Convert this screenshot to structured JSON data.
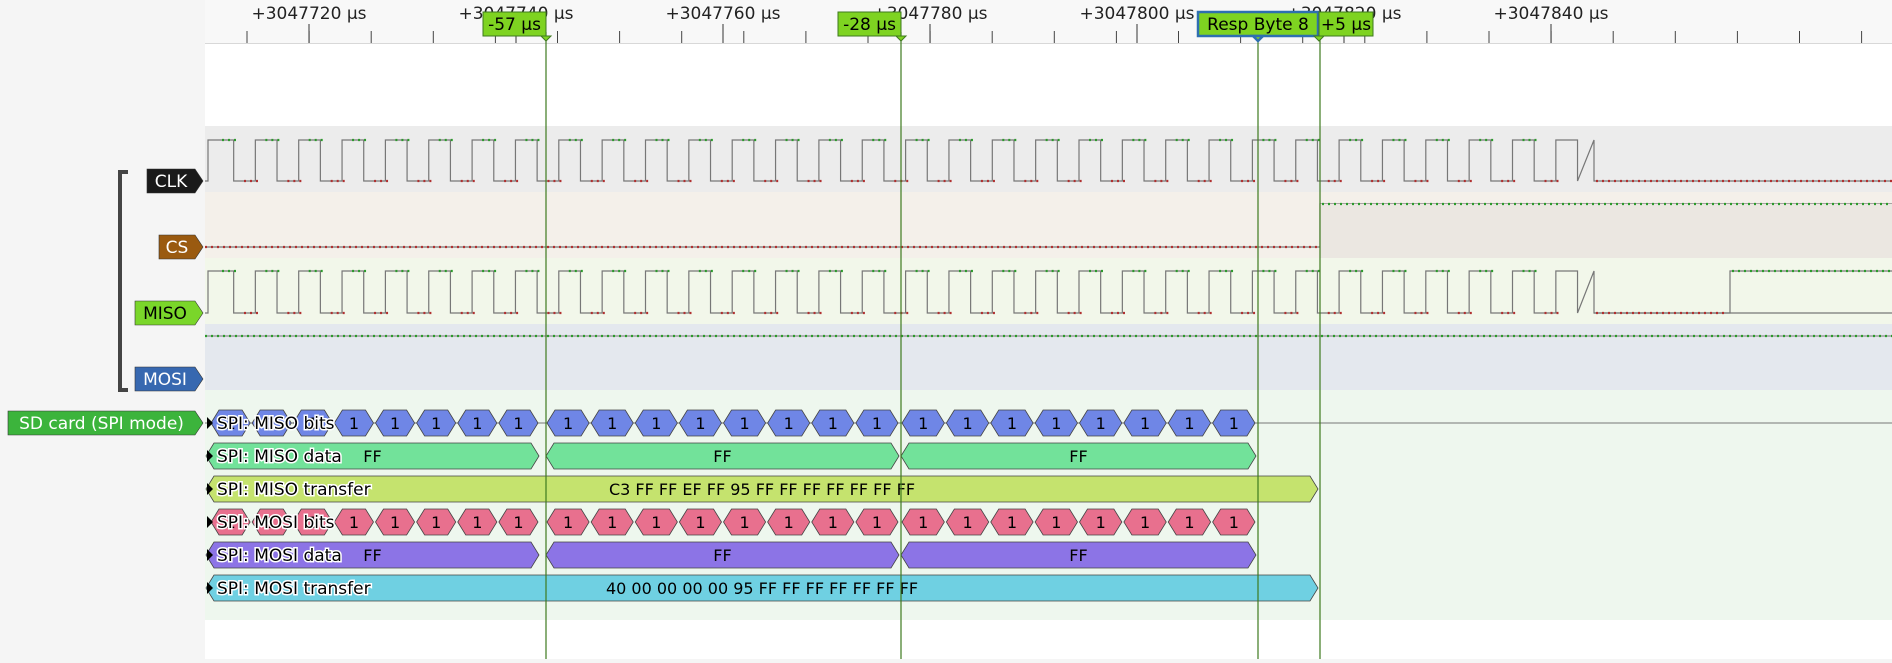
{
  "ruler": {
    "ticks": [
      {
        "label": "+3047720 µs",
        "us": 3047720
      },
      {
        "label": "+3047740 µs",
        "us": 3047740
      },
      {
        "label": "+3047760 µs",
        "us": 3047760
      },
      {
        "label": "+3047780 µs",
        "us": 3047780
      },
      {
        "label": "+3047800 µs",
        "us": 3047800
      },
      {
        "label": "+3047820 µs",
        "us": 3047820
      },
      {
        "label": "+3047840 µs",
        "us": 3047840
      }
    ]
  },
  "flags": [
    {
      "label": "-57 µs",
      "highlight": false
    },
    {
      "label": "-28 µs",
      "highlight": false
    },
    {
      "label": "Resp Byte 8",
      "highlight": true
    },
    {
      "label": "+5 µs",
      "highlight": false
    }
  ],
  "channels": [
    {
      "label": "CLK",
      "color": "#1a1a1a",
      "text_color": "#ffffff",
      "track": "#ececec"
    },
    {
      "label": "CS",
      "color": "#9a5a10",
      "text_color": "#ffffff",
      "track": "#f4f0ea"
    },
    {
      "label": "MISO",
      "color": "#7ad62a",
      "text_color": "#000000",
      "track": "#f2f7ea"
    },
    {
      "label": "MOSI",
      "color": "#3768b0",
      "text_color": "#ffffff",
      "track": "#e4e8ee"
    }
  ],
  "decoder": {
    "label": "SD card (SPI mode)",
    "color": "#3cb43c",
    "rows": [
      {
        "label": "SPI: MISO bits",
        "kind": "bits",
        "color": "#6f86e6",
        "values": [
          "1",
          "1",
          "1",
          "1",
          "1",
          "1",
          "1",
          "1",
          "1",
          "1",
          "1",
          "1",
          "1",
          "1",
          "1",
          "1",
          "1",
          "1",
          "1",
          "1",
          "1",
          "1",
          "1",
          "1"
        ]
      },
      {
        "label": "SPI: MISO data",
        "kind": "bytes",
        "color": "#72e29a",
        "values": [
          "FF",
          "FF",
          "FF"
        ]
      },
      {
        "label": "SPI: MISO transfer",
        "kind": "transfer",
        "color": "#c5e36e",
        "value": "C3 FF FF EF FF 95 FF FF FF FF FF FF FF"
      },
      {
        "label": "SPI: MOSI bits",
        "kind": "bits",
        "color": "#e8708e",
        "values": [
          "1",
          "1",
          "1",
          "1",
          "1",
          "1",
          "1",
          "1",
          "1",
          "1",
          "1",
          "1",
          "1",
          "1",
          "1",
          "1",
          "1",
          "1",
          "1",
          "1",
          "1",
          "1",
          "1",
          "1"
        ]
      },
      {
        "label": "SPI: MOSI data",
        "kind": "bytes",
        "color": "#8c74e6",
        "values": [
          "FF",
          "FF",
          "FF"
        ]
      },
      {
        "label": "SPI: MOSI transfer",
        "kind": "transfer",
        "color": "#6fd0e2",
        "value": "40 00 00 00 00 95 FF FF FF FF FF FF FF"
      }
    ]
  }
}
